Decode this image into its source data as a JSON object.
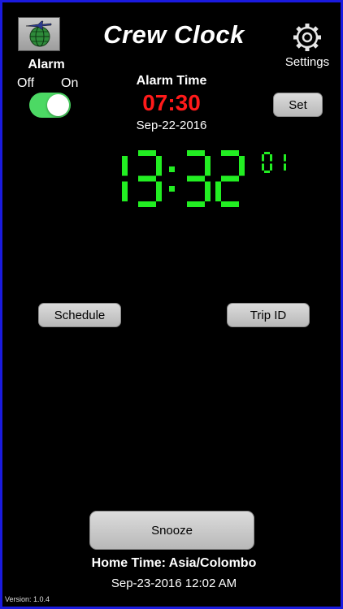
{
  "header": {
    "title": "Crew Clock",
    "settings_label": "Settings"
  },
  "alarm": {
    "label": "Alarm",
    "off_label": "Off",
    "on_label": "On",
    "enabled": true,
    "time_label": "Alarm Time",
    "time": "07:30",
    "date": "Sep-22-2016",
    "set_label": "Set"
  },
  "clock": {
    "hours": "13",
    "minutes": "32",
    "seconds": "01",
    "color": "#22ee22"
  },
  "buttons": {
    "schedule_label": "Schedule",
    "trip_id_label": "Trip ID",
    "snooze_label": "Snooze"
  },
  "home": {
    "label": "Home Time: Asia/Colombo",
    "datetime": "Sep-23-2016 12:02 AM"
  },
  "footer": {
    "version": "Version: 1.0.4"
  },
  "icons": {
    "logo": "globe-plane-icon",
    "settings": "gear-icon"
  },
  "colors": {
    "frame_border": "#1a1adf",
    "alarm_time": "#ff1a1a",
    "toggle_on": "#4cd964"
  }
}
